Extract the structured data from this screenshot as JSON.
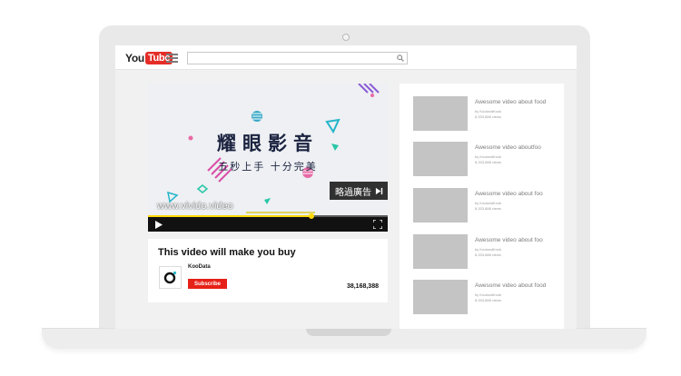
{
  "header": {
    "logo_you": "You",
    "logo_tube": "Tube",
    "search_placeholder": ""
  },
  "player": {
    "title": "耀眼影音",
    "subtitle": "五秒上手 十分完美",
    "watermark": "www.vivido.video",
    "skip_label": "略過廣告",
    "progress": 0.68
  },
  "video_info": {
    "title": "This video will make you buy",
    "channel": "KooData",
    "subscribe_label": "Subscribe",
    "views": "38,168,388"
  },
  "related": [
    {
      "title": "Awesome video about food",
      "by": "by KoolandKook",
      "views": "8,333,888 views"
    },
    {
      "title": "Awesome video aboutfoo",
      "by": "by KoolandKook",
      "views": "8,333,888 views"
    },
    {
      "title": "Awesome video about foo",
      "by": "by KoolandKook",
      "views": "8,333,888 views"
    },
    {
      "title": "Awesome video about foo",
      "by": "by KoolandKook",
      "views": "8,333,888 views"
    },
    {
      "title": "Awesome video about food",
      "by": "by KoolandKook",
      "views": "8,333,888 views"
    }
  ],
  "colors": {
    "youtube_red": "#e52d27",
    "subscribe_red": "#e62117",
    "progress_yellow": "#ffd800"
  }
}
